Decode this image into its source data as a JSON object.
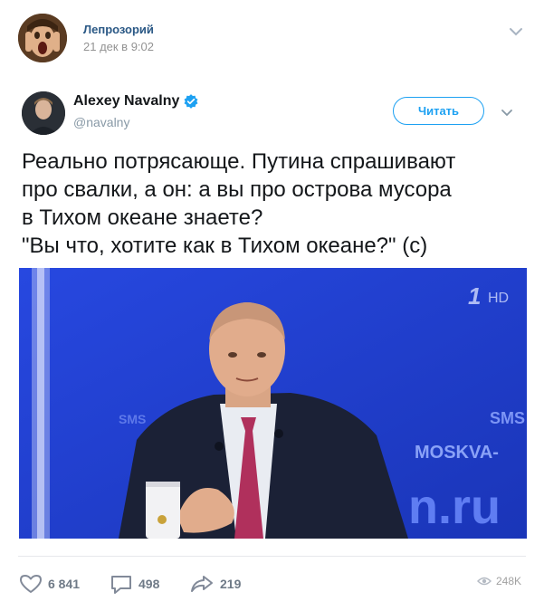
{
  "vk_post": {
    "author": "Лепрозорий",
    "date": "21 дек в 9:02",
    "avatar_icon": "screaming-face-avatar"
  },
  "tweet": {
    "name": "Alexey Navalny",
    "handle": "@navalny",
    "follow_label": "Читать",
    "text_lines": [
      "Реально потрясающе. Путина спрашивают",
      "про свалки, а он: а вы про острова мусора",
      "в Тихом океане знаете?",
      "\"Вы что, хотите как в Тихом океане?\" (с)"
    ],
    "image": {
      "channel_logo": "1",
      "hd_label": "HD",
      "background_text_sms": "SMS",
      "background_text_moskva": "MOSKVA-",
      "background_text_url": "n.ru"
    }
  },
  "actions": {
    "likes": "6 841",
    "comments": "498",
    "shares": "219",
    "views": "248K"
  },
  "colors": {
    "vk_link": "#2a5885",
    "twitter_blue": "#1da1f2",
    "studio_blue": "#1e3fd0"
  }
}
